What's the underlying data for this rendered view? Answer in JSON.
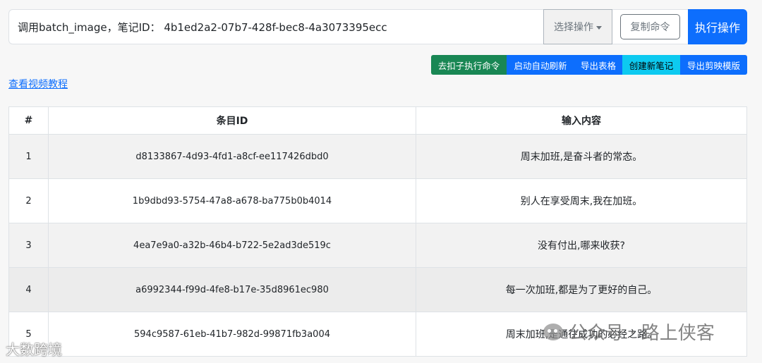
{
  "command": {
    "value": "调用batch_image，笔记ID： 4b1ed2a2-07b7-428f-bec8-4a3073395ecc",
    "select_label": "选择操作",
    "copy_label": "复制命令",
    "execute_label": "执行操作"
  },
  "actions": {
    "remove_deduction": "去扣子执行命令",
    "auto_refresh": "启动自动刷新",
    "export_table": "导出表格",
    "new_note": "创建新笔记",
    "export_template": "导出剪映模版"
  },
  "tutorial_link": "查看视频教程",
  "table": {
    "headers": [
      "#",
      "条目ID",
      "输入内容"
    ],
    "rows": [
      {
        "num": "1",
        "id": "d8133867-4d93-4fd1-a8cf-ee117426dbd0",
        "content": "周末加班,是奋斗者的常态。"
      },
      {
        "num": "2",
        "id": "1b9dbd93-5754-47a8-a678-ba775b0b4014",
        "content": "别人在享受周末,我在加班。"
      },
      {
        "num": "3",
        "id": "4ea7e9a0-a32b-46b4-b722-5e2ad3de519c",
        "content": "没有付出,哪来收获?"
      },
      {
        "num": "4",
        "id": "a6992344-f99d-4fe8-b17e-35d8961ec980",
        "content": "每一次加班,都是为了更好的自己。"
      },
      {
        "num": "5",
        "id": "594c9587-61eb-41b7-982d-99871fb3a004",
        "content": "周末加班,是通往成功的必经之路。"
      }
    ]
  },
  "watermarks": {
    "left": "大数跨境",
    "right": "公众号 · 路上侠客"
  },
  "colors": {
    "primary": "#0d6efd",
    "success": "#198754",
    "info": "#0dcaf0"
  }
}
